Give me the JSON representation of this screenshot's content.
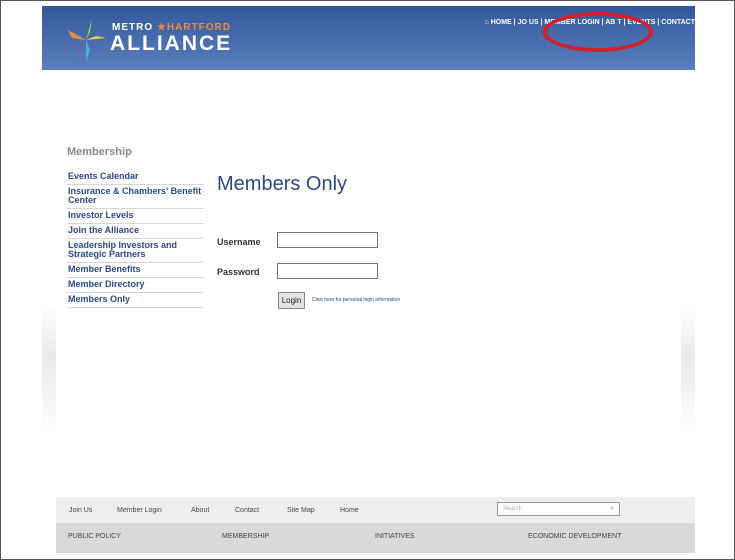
{
  "header": {
    "logo_top_left": "METRO",
    "logo_top_right": "HARTFORD",
    "logo_main": "ALLIANCE",
    "nav": [
      "HOME",
      "JOIN US",
      "MEMBER LOGIN",
      "ABOUT",
      "EVENTS",
      "CONTACT"
    ],
    "nav_visible": [
      "HOME | JO",
      "US | MEMBER LOGIN | AB",
      "T | EVENTS | CONTACT"
    ]
  },
  "sidebar": {
    "title": "Membership",
    "items": [
      {
        "label": "Events Calendar"
      },
      {
        "label": "Insurance & Chambers' Benefit Center"
      },
      {
        "label": "Investor Levels"
      },
      {
        "label": "Join the Alliance"
      },
      {
        "label": "Leadership Investors and Strategic Partners"
      },
      {
        "label": "Member Benefits"
      },
      {
        "label": "Member Directory"
      },
      {
        "label": "Members Only"
      }
    ]
  },
  "main": {
    "title": "Members Only",
    "username_label": "Username",
    "password_label": "Password",
    "username_value": "",
    "password_value": "",
    "login_label": "Login",
    "login_help_link": "Click here for personal login information"
  },
  "footer": {
    "links": [
      "Join Us",
      "Member Login",
      "About",
      "Contact",
      "Site Map",
      "Home"
    ],
    "search_placeholder": "Search",
    "search_arrow": "»",
    "sections": [
      "PUBLIC POLICY",
      "MEMBERSHIP",
      "INITIATIVES",
      "ECONOMIC DEVELOPMENT"
    ]
  },
  "colors": {
    "header_blue": "#3a5fa3",
    "link_blue": "#2c4a86",
    "highlight_red": "#d0202a"
  }
}
